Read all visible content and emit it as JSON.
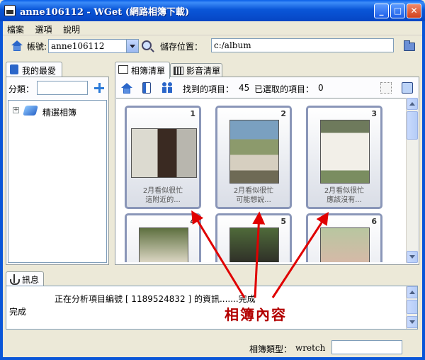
{
  "window": {
    "title": "anne106112 - WGet (網路相簿下載)"
  },
  "menu": [
    "檔案",
    "選項",
    "說明"
  ],
  "toolbar": {
    "account_label": "帳號:",
    "account_value": "anne106112",
    "save_label": "儲存位置：",
    "save_path": "c:/album"
  },
  "favorites": {
    "tab_label": "我的最愛",
    "category_label": "分類：",
    "category_value": "",
    "tree": [
      {
        "label": "精選相簿",
        "expander": "+"
      }
    ]
  },
  "album_tabs": [
    "相簿清單",
    "影音清單"
  ],
  "album_toolbar": {
    "found_label": "找到的項目：",
    "found_count": "45",
    "selected_label": "已選取的項目：",
    "selected_count": "0"
  },
  "albums": [
    {
      "num": "1",
      "caption1": "2月看似很忙",
      "caption2": "這附近的..."
    },
    {
      "num": "2",
      "caption1": "2月看似很忙",
      "caption2": "可能想說..."
    },
    {
      "num": "3",
      "caption1": "2月看似很忙",
      "caption2": "應該沒有..."
    },
    {
      "num": "4",
      "caption1": "",
      "caption2": ""
    },
    {
      "num": "5",
      "caption1": "",
      "caption2": ""
    },
    {
      "num": "6",
      "caption1": "",
      "caption2": ""
    }
  ],
  "messages": {
    "tab_label": "訊息",
    "lines": [
      "正在分析項目編號 [ 1189524832 ] 的資訊.......完成",
      "完成"
    ]
  },
  "status": {
    "album_type_label": "相簿類型：",
    "album_type_value": "wretch"
  },
  "annotation": {
    "label": "相簿內容",
    "color": "#cc0000"
  },
  "colors": {
    "titlebar": "#0a56d8",
    "card_border": "#8a96b8",
    "annotation": "#cc0000"
  }
}
